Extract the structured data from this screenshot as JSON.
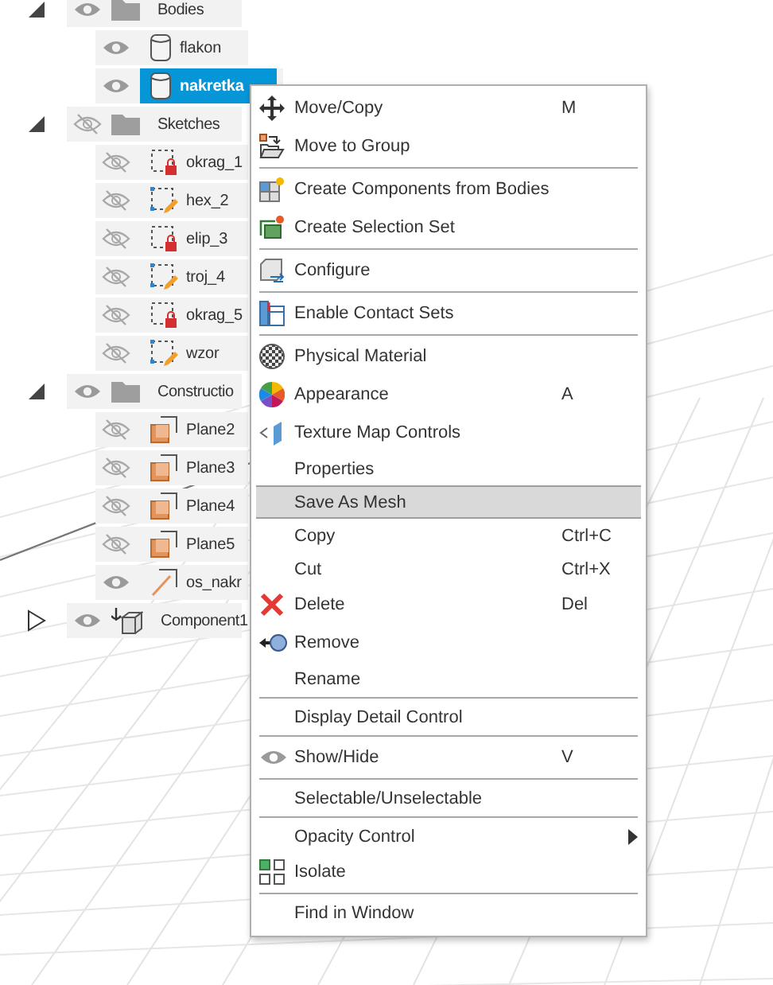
{
  "browser": {
    "nodes": [
      {
        "label": "Bodies",
        "kind": "folder",
        "visible": true,
        "expanded": true,
        "selected": false,
        "children": [
          {
            "label": "flakon",
            "kind": "body",
            "visible": true,
            "selected": false
          },
          {
            "label": "nakretka",
            "kind": "body",
            "visible": true,
            "selected": true
          }
        ]
      },
      {
        "label": "Sketches",
        "kind": "folder",
        "visible": false,
        "expanded": true,
        "selected": false,
        "children": [
          {
            "label": "okrag_1",
            "kind": "sketch-locked",
            "visible": false,
            "selected": false
          },
          {
            "label": "hex_2",
            "kind": "sketch-edit",
            "visible": false,
            "selected": false
          },
          {
            "label": "elip_3",
            "kind": "sketch-locked",
            "visible": false,
            "selected": false
          },
          {
            "label": "troj_4",
            "kind": "sketch-edit",
            "visible": false,
            "selected": false
          },
          {
            "label": "okrag_5",
            "kind": "sketch-locked",
            "visible": false,
            "selected": false
          },
          {
            "label": "wzor",
            "kind": "sketch-edit",
            "visible": false,
            "selected": false
          }
        ]
      },
      {
        "label": "Constructio",
        "kind": "folder",
        "visible": true,
        "expanded": true,
        "selected": false,
        "children": [
          {
            "label": "Plane2",
            "kind": "plane",
            "visible": false,
            "selected": false
          },
          {
            "label": "Plane3",
            "kind": "plane",
            "visible": false,
            "selected": false
          },
          {
            "label": "Plane4",
            "kind": "plane",
            "visible": false,
            "selected": false
          },
          {
            "label": "Plane5",
            "kind": "plane",
            "visible": false,
            "selected": false
          },
          {
            "label": "os_nakr",
            "kind": "axis",
            "visible": true,
            "selected": false
          }
        ]
      },
      {
        "label": "Component1",
        "kind": "component",
        "visible": true,
        "expanded": false,
        "selected": false
      }
    ]
  },
  "context_menu": {
    "groups": [
      [
        {
          "label": "Move/Copy",
          "kind": "move",
          "shortcut": "M",
          "selected": false
        },
        {
          "label": "Move to Group",
          "kind": "group",
          "selected": false
        }
      ],
      [
        {
          "label": "Create Components from Bodies",
          "kind": "components",
          "selected": false
        },
        {
          "label": "Create Selection Set",
          "kind": "selection-set",
          "selected": false
        }
      ],
      [
        {
          "label": "Configure",
          "kind": "configure",
          "selected": false
        }
      ],
      [
        {
          "label": "Enable Contact Sets",
          "kind": "contact",
          "selected": false
        }
      ],
      [
        {
          "label": "Physical Material",
          "kind": "material",
          "selected": false
        },
        {
          "label": "Appearance",
          "kind": "appearance",
          "shortcut": "A",
          "selected": false
        },
        {
          "label": "Texture Map Controls",
          "kind": "texture",
          "selected": false
        },
        {
          "label": "Properties",
          "kind": "plain",
          "selected": false
        },
        {
          "label": "Save As Mesh",
          "kind": "plain",
          "selected": true
        },
        {
          "label": "Copy",
          "kind": "plain",
          "shortcut": "Ctrl+C",
          "selected": false
        },
        {
          "label": "Cut",
          "kind": "plain",
          "shortcut": "Ctrl+X",
          "selected": false
        },
        {
          "label": "Delete",
          "kind": "delete",
          "shortcut": "Del",
          "selected": false
        },
        {
          "label": "Remove",
          "kind": "remove",
          "selected": false
        },
        {
          "label": "Rename",
          "kind": "plain",
          "selected": false
        }
      ],
      [
        {
          "label": "Display Detail Control",
          "kind": "plain",
          "selected": false
        }
      ],
      [
        {
          "label": "Show/Hide",
          "kind": "eye",
          "shortcut": "V",
          "selected": false
        }
      ],
      [
        {
          "label": "Selectable/Unselectable",
          "kind": "plain",
          "selected": false
        }
      ],
      [
        {
          "label": "Opacity Control",
          "kind": "plain",
          "submenu": true,
          "selected": false
        },
        {
          "label": "Isolate",
          "kind": "isolate",
          "selected": false
        }
      ],
      [
        {
          "label": "Find in Window",
          "kind": "plain",
          "selected": false
        }
      ]
    ]
  }
}
